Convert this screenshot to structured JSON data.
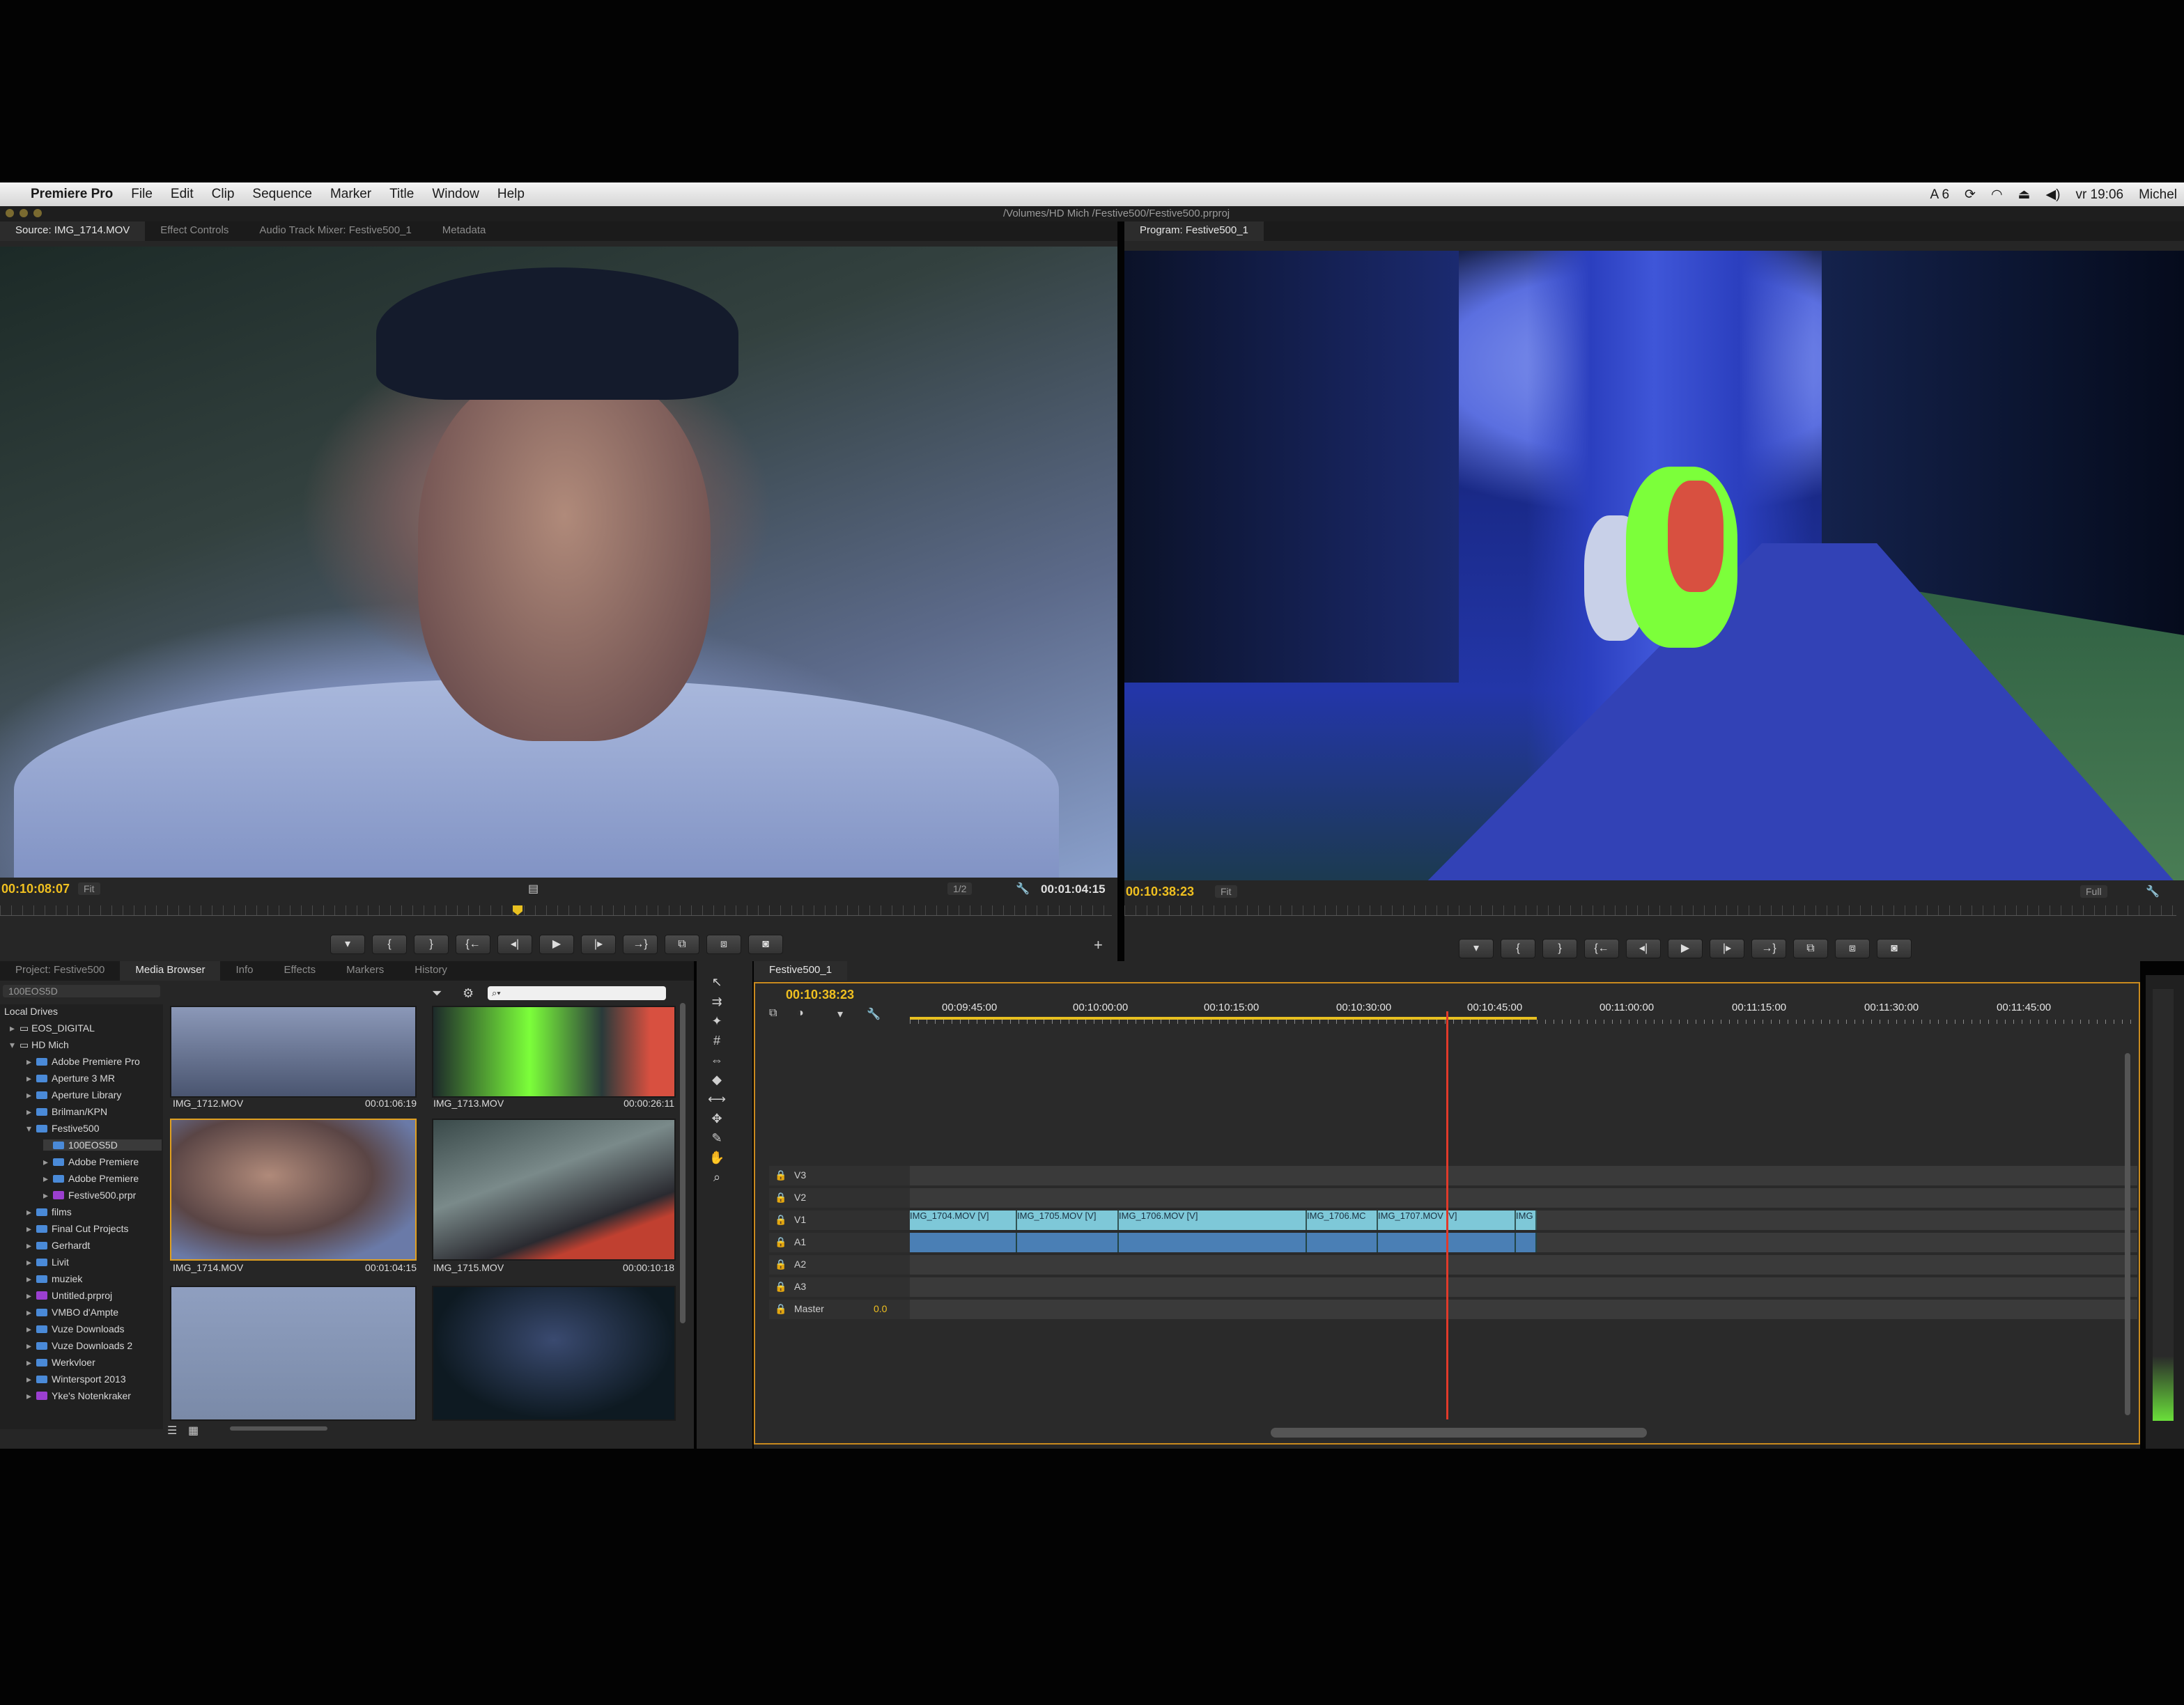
{
  "menubar": {
    "app": "Premiere Pro",
    "menus": [
      "File",
      "Edit",
      "Clip",
      "Sequence",
      "Marker",
      "Title",
      "Window",
      "Help"
    ],
    "status_clock": "vr 19:06",
    "status_user": "Michel",
    "status_adobe": "6"
  },
  "path": "/Volumes/HD Mich /Festive500/Festive500.prproj",
  "source_panel": {
    "tabs": [
      "Source: IMG_1714.MOV",
      "Effect Controls",
      "Audio Track Mixer: Festive500_1",
      "Metadata"
    ],
    "timecode_in": "00:10:08:07",
    "fit": "Fit",
    "resolution": "1/2",
    "duration": "00:01:04:15"
  },
  "program_panel": {
    "tab": "Program: Festive500_1",
    "timecode": "00:10:38:23",
    "fit": "Fit",
    "quality": "Full"
  },
  "transport_icons": [
    "marker-icon",
    "mark-in-icon",
    "mark-out-icon",
    "go-to-in-icon",
    "step-back-icon",
    "play-icon",
    "step-forward-icon",
    "go-to-out-icon",
    "insert-icon",
    "overwrite-icon",
    "export-frame-icon"
  ],
  "transport_glyphs": [
    "▾",
    "{",
    "}",
    "{←",
    "◂|",
    "▶",
    "|▸",
    "→}",
    "⧉",
    "⧈",
    "◙"
  ],
  "project_panel": {
    "tabs": [
      "Project: Festive500",
      "Media Browser",
      "Info",
      "Effects",
      "Markers",
      "History"
    ],
    "location": "100EOS5D",
    "tree": [
      {
        "label": "Local Drives",
        "kind": "header"
      },
      {
        "label": "EOS_DIGITAL",
        "kind": "drive"
      },
      {
        "label": "HD Mich",
        "kind": "drive"
      },
      {
        "label": "Adobe Premiere Pro",
        "kind": "folder"
      },
      {
        "label": "Aperture 3 MR",
        "kind": "folder"
      },
      {
        "label": "Aperture Library",
        "kind": "folder"
      },
      {
        "label": "Brilman/KPN",
        "kind": "folder"
      },
      {
        "label": "Festive500",
        "kind": "folder"
      },
      {
        "label": "100EOS5D",
        "kind": "folder",
        "selected": true
      },
      {
        "label": "Adobe Premiere",
        "kind": "folder"
      },
      {
        "label": "Adobe Premiere",
        "kind": "folder"
      },
      {
        "label": "Festive500.prpr",
        "kind": "project"
      },
      {
        "label": "films",
        "kind": "folder"
      },
      {
        "label": "Final Cut Projects",
        "kind": "folder"
      },
      {
        "label": "Gerhardt",
        "kind": "folder"
      },
      {
        "label": "Livit",
        "kind": "folder"
      },
      {
        "label": "muziek",
        "kind": "folder"
      },
      {
        "label": "Untitled.prproj",
        "kind": "project"
      },
      {
        "label": "VMBO d'Ampte",
        "kind": "folder"
      },
      {
        "label": "Vuze Downloads",
        "kind": "folder"
      },
      {
        "label": "Vuze Downloads 2",
        "kind": "folder"
      },
      {
        "label": "Werkvloer",
        "kind": "folder"
      },
      {
        "label": "Wintersport 2013",
        "kind": "folder"
      },
      {
        "label": "Yke's Notenkraker",
        "kind": "project"
      }
    ],
    "clips": [
      {
        "name": "IMG_1712.MOV",
        "duration": "00:01:06:19"
      },
      {
        "name": "IMG_1713.MOV",
        "duration": "00:00:26:11"
      },
      {
        "name": "IMG_1714.MOV",
        "duration": "00:01:04:15"
      },
      {
        "name": "IMG_1715.MOV",
        "duration": "00:00:10:18"
      }
    ]
  },
  "timeline": {
    "tab": "Festive500_1",
    "timecode": "00:10:38:23",
    "ruler": [
      "00:09:45:00",
      "00:10:00:00",
      "00:10:15:00",
      "00:10:30:00",
      "00:10:45:00",
      "00:11:00:00",
      "00:11:15:00",
      "00:11:30:00",
      "00:11:45:00"
    ],
    "video_tracks": [
      "V3",
      "V2",
      "V1"
    ],
    "audio_tracks": [
      "A1",
      "A2",
      "A3"
    ],
    "master_label": "Master",
    "master_value": "0.0",
    "clips": [
      "IMG_1704.MOV [V]",
      "IMG_1705.MOV [V]",
      "IMG_1706.MOV [V]",
      "IMG_1706.MC",
      "IMG_1707.MOV [V]",
      "IMG"
    ]
  }
}
